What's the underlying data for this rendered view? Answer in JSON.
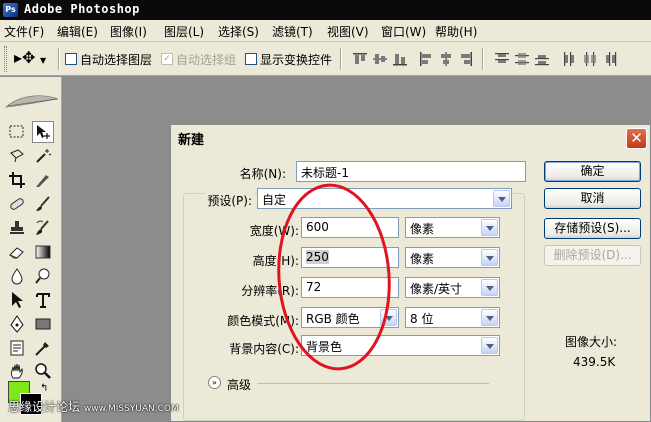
{
  "app": {
    "title": "Adobe Photoshop",
    "icon": "photoshop-app-icon"
  },
  "menubar": {
    "items": [
      "文件(F)",
      "编辑(E)",
      "图像(I)",
      "图层(L)",
      "选择(S)",
      "滤镜(T)",
      "视图(V)",
      "窗口(W)",
      "帮助(H)"
    ]
  },
  "options": {
    "auto_select_layer": "自动选择图层",
    "auto_select_group": "自动选择组",
    "show_transform": "显示变换控件",
    "auto_select_group_checked": true
  },
  "dialog": {
    "title": "新建",
    "name_label": "名称(N):",
    "name_value": "未标题-1",
    "preset_label": "预设(P):",
    "preset_value": "自定",
    "width_label": "宽度(W):",
    "width_value": "600",
    "width_unit": "像素",
    "height_label": "高度(H):",
    "height_value": "250",
    "height_unit": "像素",
    "resolution_label": "分辨率(R):",
    "resolution_value": "72",
    "resolution_unit": "像素/英寸",
    "color_mode_label": "颜色模式(M):",
    "color_mode_value": "RGB 颜色",
    "bit_depth_value": "8 位",
    "background_label": "背景内容(C):",
    "background_value": "背景色",
    "advanced_label": "高级",
    "image_size_label": "图像大小:",
    "image_size_value": "439.5K",
    "buttons": {
      "ok": "确定",
      "cancel": "取消",
      "save_preset": "存储预设(S)...",
      "delete_preset": "删除预设(D)..."
    }
  },
  "colors": {
    "foreground": "#7ee81a",
    "background": "#000000",
    "annotation": "#e0141e"
  },
  "watermark": {
    "text": "思缘设计论坛",
    "url": "www.MISSYUAN.COM"
  }
}
